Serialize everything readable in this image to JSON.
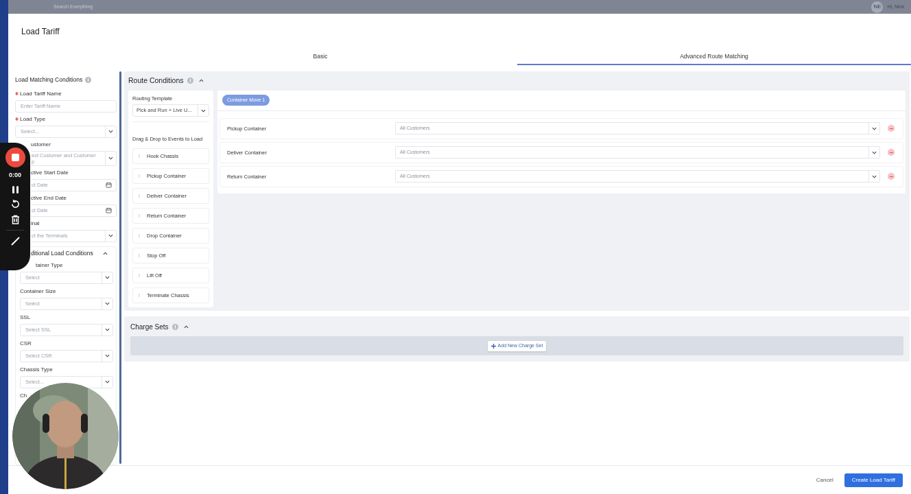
{
  "backdrop": {
    "search_placeholder": "Search Everything",
    "avatar": "NE",
    "greeting": "Hi, New"
  },
  "modal": {
    "title": "Load Tariff"
  },
  "tabs": [
    {
      "label": "Basic",
      "selected": false
    },
    {
      "label": "Advanced Route Matching",
      "selected": true
    }
  ],
  "load_matching": {
    "title": "Load Matching Conditions",
    "fields": [
      {
        "label": "Load Tariff Name",
        "required": true,
        "kind": "text",
        "placeholder": "Enter Tariff Name"
      },
      {
        "label": "Load Type",
        "required": true,
        "kind": "select",
        "placeholder": "Select..."
      },
      {
        "label": "ustomer",
        "required": false,
        "kind": "select",
        "placeholder_lines": [
          "ect Customer and Customer",
          "p"
        ]
      },
      {
        "label": "ctive Start Date",
        "required": false,
        "kind": "date",
        "placeholder": "ct Date"
      },
      {
        "label": "ctive End Date",
        "required": false,
        "kind": "date",
        "placeholder": "ct Date"
      },
      {
        "label": "inal",
        "required": false,
        "kind": "select",
        "placeholder": "ct the Terminals"
      }
    ]
  },
  "additional": {
    "title": "ditional Load Conditions",
    "expanded": true,
    "fields": [
      {
        "label": "tainer Type",
        "kind": "select",
        "placeholder": "Select"
      },
      {
        "label": "Container Size",
        "kind": "select",
        "placeholder": "Select"
      },
      {
        "label": "SSL",
        "kind": "select",
        "placeholder": "Select SSL"
      },
      {
        "label": "CSR",
        "kind": "select",
        "placeholder": "Select CSR"
      },
      {
        "label": "Chassis Type",
        "kind": "select",
        "placeholder": "Select..."
      },
      {
        "label": "Ch",
        "kind": "label"
      }
    ]
  },
  "route_conditions": {
    "title": "Route Conditions",
    "expanded": true,
    "routing_template": {
      "label": "Routing Template",
      "value": "Pick and Run + Live U..."
    },
    "events_title": "Drag & Drop to Events to Load",
    "events": [
      "Hook Chassis",
      "Pickup Container",
      "Deliver Container",
      "Return Container",
      "Drop Container",
      "Stop Off",
      "Lift Off",
      "Terminate Chassis"
    ],
    "moves": [
      {
        "label": "Container Move 1",
        "selected": true
      }
    ],
    "rows": [
      {
        "event": "Pickup Container",
        "placeholder": "All Customers"
      },
      {
        "event": "Deliver Container",
        "placeholder": "All Customers"
      },
      {
        "event": "Return Container",
        "placeholder": "All Customers"
      }
    ]
  },
  "charge_sets": {
    "title": "Charge Sets",
    "expanded": true,
    "add_button": "Add New Charge Set"
  },
  "footer": {
    "cancel": "Cancel",
    "submit": "Create Load Tariff"
  },
  "recorder": {
    "time": "0:00"
  }
}
